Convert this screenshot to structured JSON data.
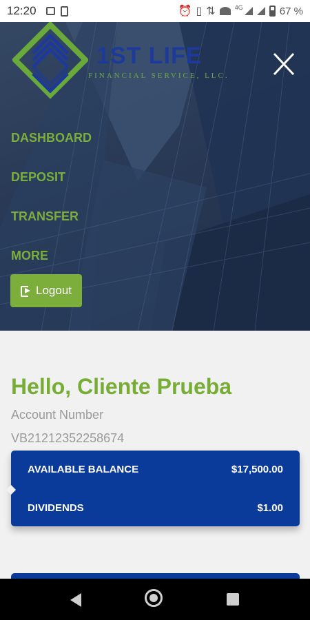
{
  "status_bar": {
    "time": "12:20",
    "network": "4G",
    "battery_percent": "67 %"
  },
  "brand": {
    "name": "1ST LIFE",
    "subtitle": "FINANCIAL SERVICE, LLC."
  },
  "menu": {
    "items": [
      {
        "label": "DASHBOARD"
      },
      {
        "label": "DEPOSIT"
      },
      {
        "label": "TRANSFER"
      },
      {
        "label": "MORE"
      }
    ],
    "logout_label": "Logout",
    "close_icon": "close-icon"
  },
  "account": {
    "greeting": "Hello, Cliente Prueba",
    "number_label": "Account Number",
    "number": "VB21212352258674"
  },
  "balances": {
    "available_label": "AVAILABLE BALANCE",
    "available_value": "$17,500.00",
    "dividends_label": "DIVIDENDS",
    "dividends_value": "$1.00"
  },
  "colors": {
    "accent_green": "#7cae3c",
    "card_blue": "#0a3a9a"
  }
}
